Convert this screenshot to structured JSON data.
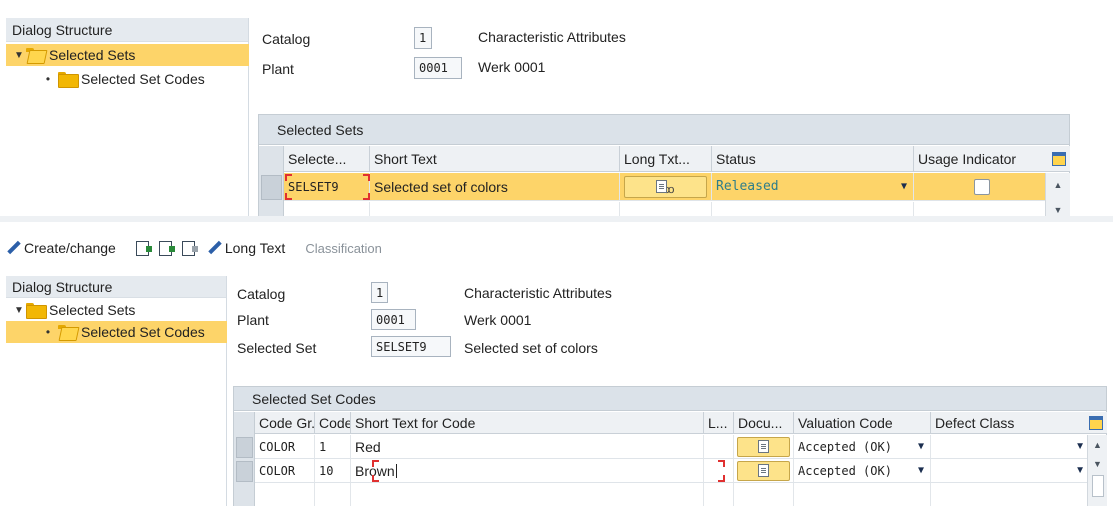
{
  "top": {
    "dialog_structure": {
      "title": "Dialog Structure",
      "items": [
        {
          "label": "Selected Sets",
          "selected": true
        },
        {
          "label": "Selected Set Codes",
          "selected": false
        }
      ]
    },
    "header": {
      "catalog_label": "Catalog",
      "catalog_value": "1",
      "catalog_text": "Characteristic Attributes",
      "plant_label": "Plant",
      "plant_value": "0001",
      "plant_text": "Werk 0001"
    },
    "grid": {
      "title": "Selected Sets",
      "columns": [
        "Selecte...",
        "Short Text",
        "Long Txt...",
        "Status",
        "Usage Indicator"
      ],
      "rows": [
        {
          "selected_set": "SELSET9",
          "short_text": "Selected set of colors",
          "status": "Released",
          "usage_indicator": false
        }
      ]
    }
  },
  "toolbar": {
    "create_change": "Create/change",
    "long_text": "Long Text",
    "classification": "Classification"
  },
  "bottom": {
    "dialog_structure": {
      "title": "Dialog Structure",
      "items": [
        {
          "label": "Selected Sets",
          "selected": false
        },
        {
          "label": "Selected Set Codes",
          "selected": true
        }
      ]
    },
    "header": {
      "catalog_label": "Catalog",
      "catalog_value": "1",
      "catalog_text": "Characteristic Attributes",
      "plant_label": "Plant",
      "plant_value": "0001",
      "plant_text": "Werk 0001",
      "set_label": "Selected Set",
      "set_value": "SELSET9",
      "set_text": "Selected set of colors"
    },
    "grid": {
      "title": "Selected Set Codes",
      "columns": [
        "Code Gr...",
        "Code",
        "Short Text for Code",
        "L...",
        "Docu...",
        "Valuation Code",
        "Defect Class"
      ],
      "rows": [
        {
          "code_group": "COLOR",
          "code": "1",
          "short_text": "Red",
          "valuation": "Accepted (OK)",
          "defect_class": ""
        },
        {
          "code_group": "COLOR",
          "code": "10",
          "short_text": "Brown",
          "valuation": "Accepted (OK)",
          "defect_class": ""
        }
      ]
    }
  },
  "colors": {
    "selection": "#fdd469",
    "panel_header": "#e5eaef",
    "grid_title": "#dbe2e9",
    "status_text": "#2e7d8a",
    "required_marker": "#e03030"
  }
}
